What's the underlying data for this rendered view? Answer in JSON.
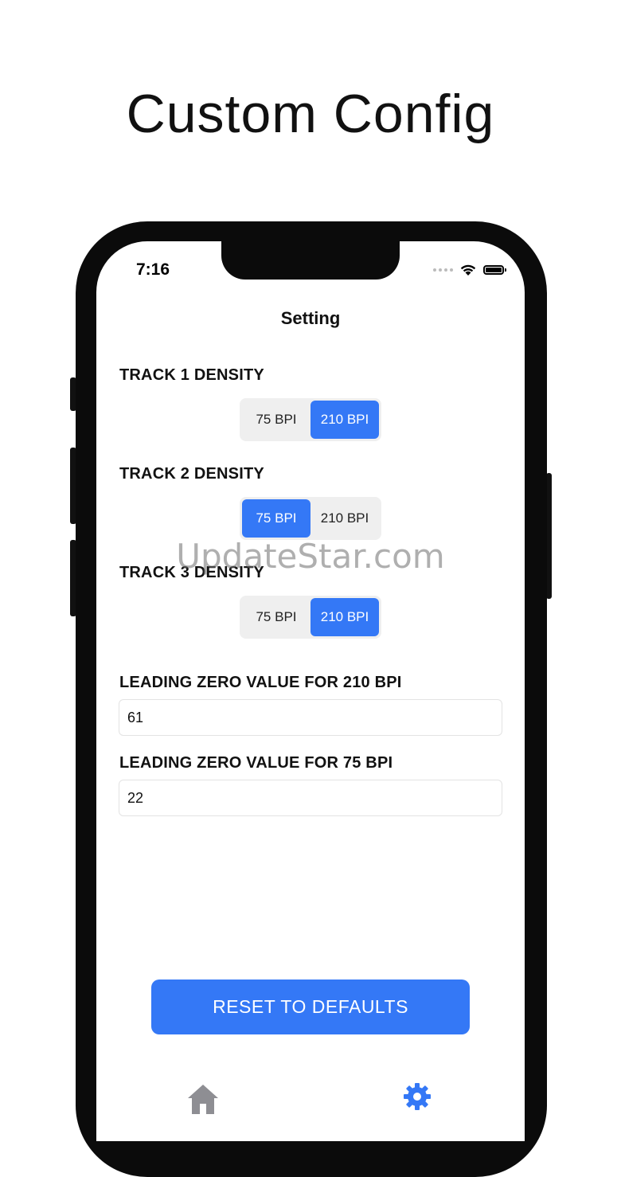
{
  "headline": "Custom Config",
  "status": {
    "time": "7:16"
  },
  "nav": {
    "title": "Setting"
  },
  "track1": {
    "label": "TRACK 1 DENSITY",
    "options": [
      "75 BPI",
      "210 BPI"
    ],
    "selected": "210 BPI"
  },
  "track2": {
    "label": "TRACK 2 DENSITY",
    "options": [
      "75 BPI",
      "210 BPI"
    ],
    "selected": "75 BPI"
  },
  "track3": {
    "label": "TRACK 3 DENSITY",
    "options": [
      "75 BPI",
      "210 BPI"
    ],
    "selected": "210 BPI"
  },
  "leading210": {
    "label": "LEADING ZERO VALUE FOR 210 BPI",
    "value": "61"
  },
  "leading75": {
    "label": "LEADING ZERO VALUE FOR 75 BPI",
    "value": "22"
  },
  "reset_label": "RESET TO DEFAULTS",
  "watermark": "UpdateStar.com",
  "colors": {
    "accent": "#3478f6",
    "segment_bg": "#efefef"
  },
  "icons": {
    "tab_home": "home-icon",
    "tab_settings": "gear-icon"
  }
}
